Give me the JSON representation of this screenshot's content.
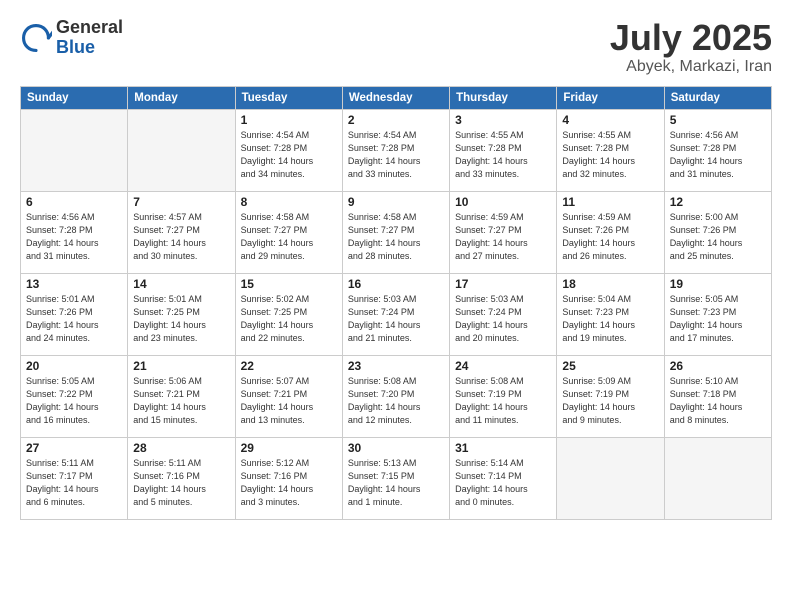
{
  "header": {
    "logo_general": "General",
    "logo_blue": "Blue",
    "title": "July 2025",
    "location": "Abyek, Markazi, Iran"
  },
  "weekdays": [
    "Sunday",
    "Monday",
    "Tuesday",
    "Wednesday",
    "Thursday",
    "Friday",
    "Saturday"
  ],
  "weeks": [
    [
      {
        "day": "",
        "info": ""
      },
      {
        "day": "",
        "info": ""
      },
      {
        "day": "1",
        "info": "Sunrise: 4:54 AM\nSunset: 7:28 PM\nDaylight: 14 hours\nand 34 minutes."
      },
      {
        "day": "2",
        "info": "Sunrise: 4:54 AM\nSunset: 7:28 PM\nDaylight: 14 hours\nand 33 minutes."
      },
      {
        "day": "3",
        "info": "Sunrise: 4:55 AM\nSunset: 7:28 PM\nDaylight: 14 hours\nand 33 minutes."
      },
      {
        "day": "4",
        "info": "Sunrise: 4:55 AM\nSunset: 7:28 PM\nDaylight: 14 hours\nand 32 minutes."
      },
      {
        "day": "5",
        "info": "Sunrise: 4:56 AM\nSunset: 7:28 PM\nDaylight: 14 hours\nand 31 minutes."
      }
    ],
    [
      {
        "day": "6",
        "info": "Sunrise: 4:56 AM\nSunset: 7:28 PM\nDaylight: 14 hours\nand 31 minutes."
      },
      {
        "day": "7",
        "info": "Sunrise: 4:57 AM\nSunset: 7:27 PM\nDaylight: 14 hours\nand 30 minutes."
      },
      {
        "day": "8",
        "info": "Sunrise: 4:58 AM\nSunset: 7:27 PM\nDaylight: 14 hours\nand 29 minutes."
      },
      {
        "day": "9",
        "info": "Sunrise: 4:58 AM\nSunset: 7:27 PM\nDaylight: 14 hours\nand 28 minutes."
      },
      {
        "day": "10",
        "info": "Sunrise: 4:59 AM\nSunset: 7:27 PM\nDaylight: 14 hours\nand 27 minutes."
      },
      {
        "day": "11",
        "info": "Sunrise: 4:59 AM\nSunset: 7:26 PM\nDaylight: 14 hours\nand 26 minutes."
      },
      {
        "day": "12",
        "info": "Sunrise: 5:00 AM\nSunset: 7:26 PM\nDaylight: 14 hours\nand 25 minutes."
      }
    ],
    [
      {
        "day": "13",
        "info": "Sunrise: 5:01 AM\nSunset: 7:26 PM\nDaylight: 14 hours\nand 24 minutes."
      },
      {
        "day": "14",
        "info": "Sunrise: 5:01 AM\nSunset: 7:25 PM\nDaylight: 14 hours\nand 23 minutes."
      },
      {
        "day": "15",
        "info": "Sunrise: 5:02 AM\nSunset: 7:25 PM\nDaylight: 14 hours\nand 22 minutes."
      },
      {
        "day": "16",
        "info": "Sunrise: 5:03 AM\nSunset: 7:24 PM\nDaylight: 14 hours\nand 21 minutes."
      },
      {
        "day": "17",
        "info": "Sunrise: 5:03 AM\nSunset: 7:24 PM\nDaylight: 14 hours\nand 20 minutes."
      },
      {
        "day": "18",
        "info": "Sunrise: 5:04 AM\nSunset: 7:23 PM\nDaylight: 14 hours\nand 19 minutes."
      },
      {
        "day": "19",
        "info": "Sunrise: 5:05 AM\nSunset: 7:23 PM\nDaylight: 14 hours\nand 17 minutes."
      }
    ],
    [
      {
        "day": "20",
        "info": "Sunrise: 5:05 AM\nSunset: 7:22 PM\nDaylight: 14 hours\nand 16 minutes."
      },
      {
        "day": "21",
        "info": "Sunrise: 5:06 AM\nSunset: 7:21 PM\nDaylight: 14 hours\nand 15 minutes."
      },
      {
        "day": "22",
        "info": "Sunrise: 5:07 AM\nSunset: 7:21 PM\nDaylight: 14 hours\nand 13 minutes."
      },
      {
        "day": "23",
        "info": "Sunrise: 5:08 AM\nSunset: 7:20 PM\nDaylight: 14 hours\nand 12 minutes."
      },
      {
        "day": "24",
        "info": "Sunrise: 5:08 AM\nSunset: 7:19 PM\nDaylight: 14 hours\nand 11 minutes."
      },
      {
        "day": "25",
        "info": "Sunrise: 5:09 AM\nSunset: 7:19 PM\nDaylight: 14 hours\nand 9 minutes."
      },
      {
        "day": "26",
        "info": "Sunrise: 5:10 AM\nSunset: 7:18 PM\nDaylight: 14 hours\nand 8 minutes."
      }
    ],
    [
      {
        "day": "27",
        "info": "Sunrise: 5:11 AM\nSunset: 7:17 PM\nDaylight: 14 hours\nand 6 minutes."
      },
      {
        "day": "28",
        "info": "Sunrise: 5:11 AM\nSunset: 7:16 PM\nDaylight: 14 hours\nand 5 minutes."
      },
      {
        "day": "29",
        "info": "Sunrise: 5:12 AM\nSunset: 7:16 PM\nDaylight: 14 hours\nand 3 minutes."
      },
      {
        "day": "30",
        "info": "Sunrise: 5:13 AM\nSunset: 7:15 PM\nDaylight: 14 hours\nand 1 minute."
      },
      {
        "day": "31",
        "info": "Sunrise: 5:14 AM\nSunset: 7:14 PM\nDaylight: 14 hours\nand 0 minutes."
      },
      {
        "day": "",
        "info": ""
      },
      {
        "day": "",
        "info": ""
      }
    ]
  ]
}
